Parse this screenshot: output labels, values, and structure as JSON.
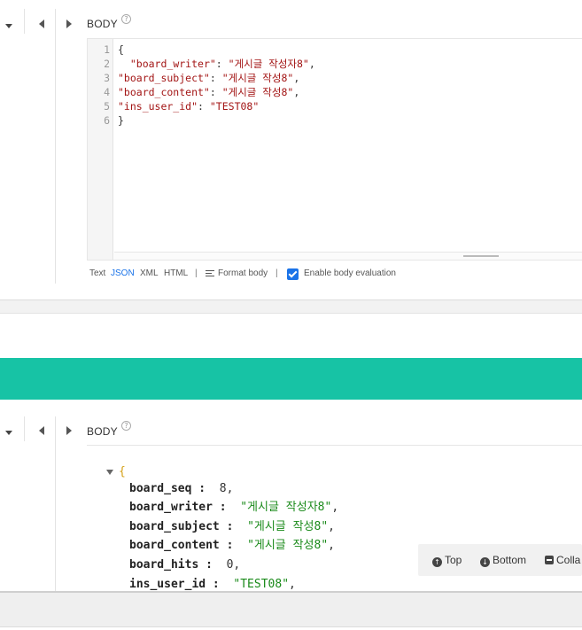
{
  "top_panel": {
    "body_label": "BODY",
    "help_glyph": "?",
    "line_numbers": [
      "1",
      "2",
      "3",
      "4",
      "5",
      "6"
    ],
    "code_lines": [
      {
        "plain_before": "{",
        "string": "",
        "plain_after": ""
      },
      {
        "plain_before": "  ",
        "string": "\"board_writer\"",
        "plain_after": ": ",
        "value": "\"게시글 작성자8\"",
        "tail": ","
      },
      {
        "plain_before": "",
        "string": "\"board_subject\"",
        "plain_after": ": ",
        "value": "\"게시글 작성8\"",
        "tail": ","
      },
      {
        "plain_before": "",
        "string": "\"board_content\"",
        "plain_after": ": ",
        "value": "\"게시글 작성8\"",
        "tail": ","
      },
      {
        "plain_before": "",
        "string": "\"ins_user_id\"",
        "plain_after": ": ",
        "value": "\"TEST08\"",
        "tail": ""
      },
      {
        "plain_before": "}",
        "string": "",
        "plain_after": ""
      }
    ],
    "format_options": {
      "text": "Text",
      "json": "JSON",
      "xml": "XML",
      "html": "HTML",
      "separator": "|",
      "format_body": "Format body",
      "enable_evaluation": "Enable body evaluation"
    },
    "enable_evaluation_checked": true,
    "active_format": "JSON"
  },
  "response_panel": {
    "body_label": "BODY",
    "help_glyph": "?",
    "open_brace": "{",
    "fields": [
      {
        "key": "board_seq",
        "sep": " :  ",
        "value": "8",
        "type": "number",
        "tail": ","
      },
      {
        "key": "board_writer",
        "sep": " :  ",
        "value": "\"게시글 작성자8\"",
        "type": "string",
        "tail": ","
      },
      {
        "key": "board_subject",
        "sep": " :  ",
        "value": "\"게시글 작성8\"",
        "type": "string",
        "tail": ","
      },
      {
        "key": "board_content",
        "sep": " :  ",
        "value": "\"게시글 작성8\"",
        "type": "string",
        "tail": ","
      },
      {
        "key": "board_hits",
        "sep": " :  ",
        "value": "0",
        "type": "number",
        "tail": ","
      },
      {
        "key": "ins_user_id",
        "sep": " :  ",
        "value": "\"TEST08\"",
        "type": "string",
        "tail": ","
      }
    ]
  },
  "float_bar": {
    "top": "Top",
    "bottom": "Bottom",
    "collapse": "Colla"
  },
  "colors": {
    "accent_band": "#17c3a5",
    "link_blue": "#1a73e8",
    "string_red": "#a31515",
    "string_green": "#1a8a1a"
  }
}
